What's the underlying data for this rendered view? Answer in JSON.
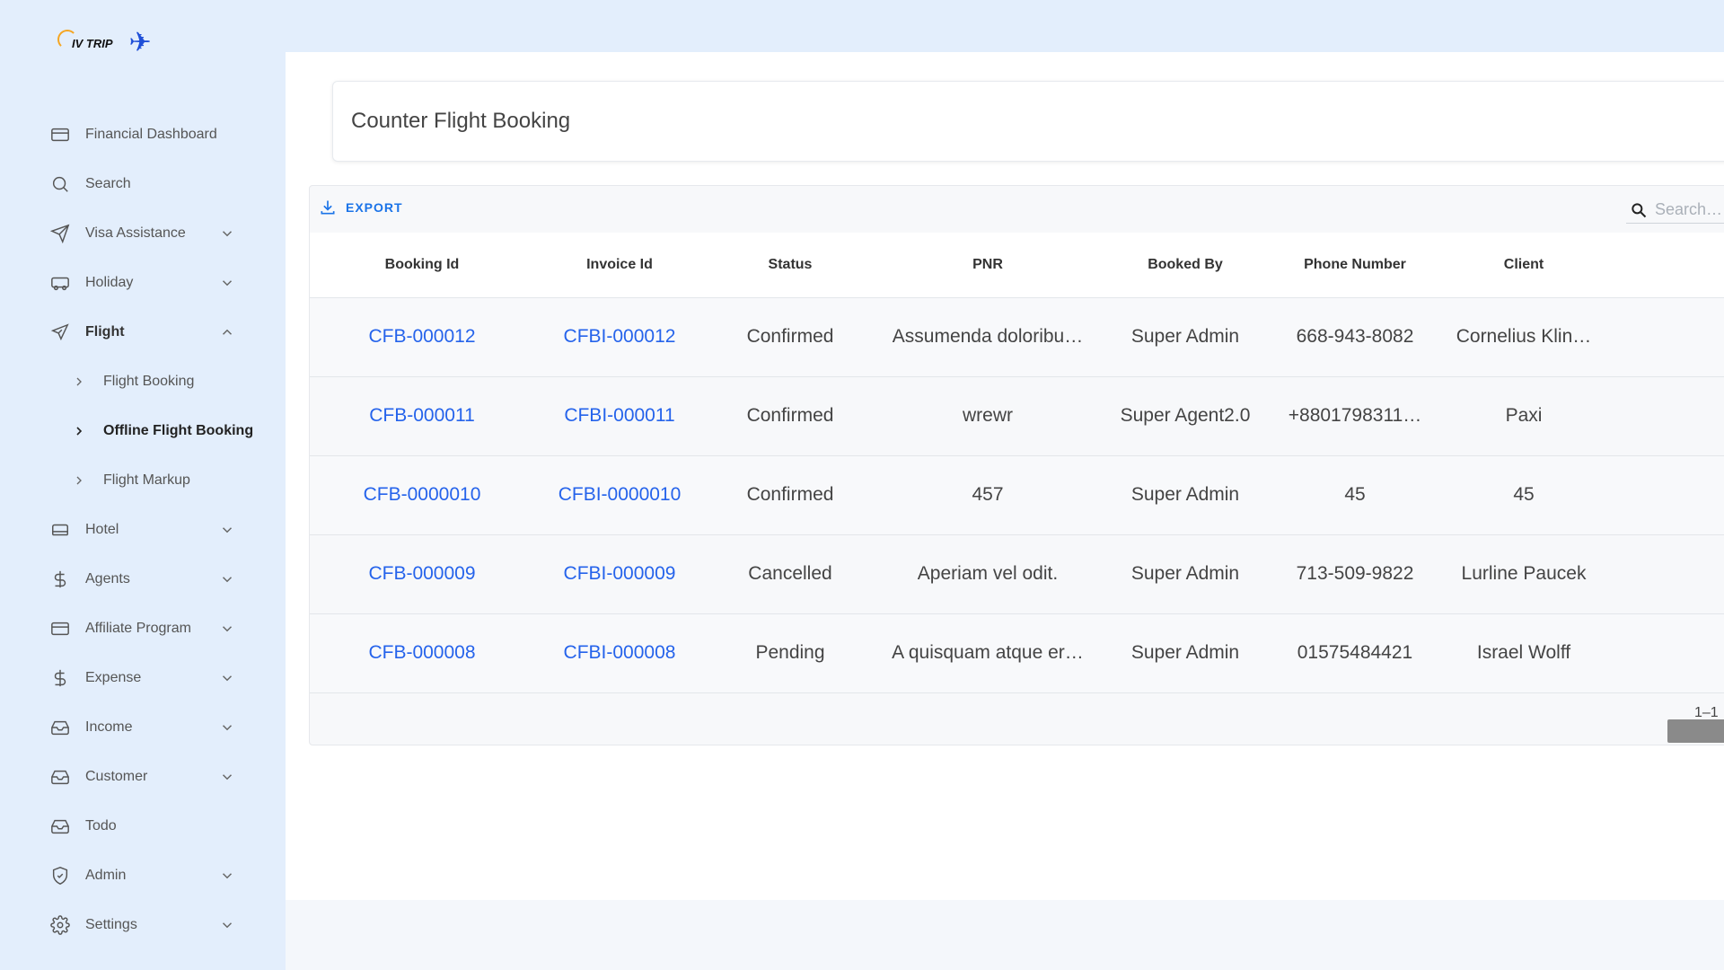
{
  "brand": {
    "logo_text": "IV TRIP"
  },
  "sidebar": {
    "items": [
      {
        "label": "Financial Dashboard",
        "icon": "credit-card-icon",
        "has_chevron": false
      },
      {
        "label": "Search",
        "icon": "search-icon",
        "has_chevron": false
      },
      {
        "label": "Visa Assistance",
        "icon": "send-icon",
        "has_chevron": true
      },
      {
        "label": "Holiday",
        "icon": "van-icon",
        "has_chevron": true
      },
      {
        "label": "Flight",
        "icon": "plane-icon",
        "has_chevron": true,
        "expanded": true
      },
      {
        "label": "Hotel",
        "icon": "bed-icon",
        "has_chevron": true
      },
      {
        "label": "Agents",
        "icon": "dollar-icon",
        "has_chevron": true
      },
      {
        "label": "Affiliate Program",
        "icon": "credit-card-icon",
        "has_chevron": true
      },
      {
        "label": "Expense",
        "icon": "dollar-icon",
        "has_chevron": true
      },
      {
        "label": "Income",
        "icon": "inbox-icon",
        "has_chevron": true
      },
      {
        "label": "Customer",
        "icon": "inbox-icon",
        "has_chevron": true
      },
      {
        "label": "Todo",
        "icon": "inbox-icon",
        "has_chevron": false
      },
      {
        "label": "Admin",
        "icon": "shield-icon",
        "has_chevron": true
      },
      {
        "label": "Settings",
        "icon": "gear-icon",
        "has_chevron": true
      }
    ],
    "flight_sub": [
      {
        "label": "Flight Booking"
      },
      {
        "label": "Offline Flight Booking",
        "selected": true
      },
      {
        "label": "Flight Markup"
      }
    ]
  },
  "page": {
    "title": "Counter Flight Booking"
  },
  "toolbar": {
    "export_label": "EXPORT",
    "search_placeholder": "Search…"
  },
  "table": {
    "columns": [
      "Booking Id",
      "Invoice Id",
      "Status",
      "PNR",
      "Booked By",
      "Phone Number",
      "Client"
    ],
    "rows": [
      [
        "CFB-000012",
        "CFBI-000012",
        "Confirmed",
        "Assumenda doloribu…",
        "Super Admin",
        "668-943-8082",
        "Cornelius Klin…"
      ],
      [
        "CFB-000011",
        "CFBI-000011",
        "Confirmed",
        "wrewr",
        "Super Agent2.0",
        "+8801798311…",
        "Paxi"
      ],
      [
        "CFB-0000010",
        "CFBI-0000010",
        "Confirmed",
        "457",
        "Super Admin",
        "45",
        "45"
      ],
      [
        "CFB-000009",
        "CFBI-000009",
        "Cancelled",
        "Aperiam vel odit.",
        "Super Admin",
        "713-509-9822",
        "Lurline Paucek"
      ],
      [
        "CFB-000008",
        "CFBI-000008",
        "Pending",
        "A quisquam atque er…",
        "Super Admin",
        "01575484421",
        "Israel Wolff"
      ]
    ]
  },
  "pagination": {
    "text": "1–1"
  },
  "colors": {
    "accent": "#2563eb",
    "sidebar_bg": "#e3eefc",
    "logo_orange": "#f5a623",
    "logo_blue": "#1f4fd8"
  }
}
